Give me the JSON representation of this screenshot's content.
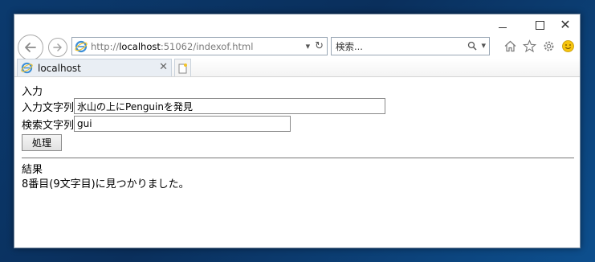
{
  "window": {
    "controls": {
      "minimize": "minimize-icon",
      "maximize": "maximize-icon",
      "close": "close-icon"
    }
  },
  "navbar": {
    "address": {
      "url_prefix": "http://",
      "url_host": "localhost",
      "url_rest": ":51062/indexof.html"
    },
    "search_placeholder": "検索...",
    "toolbar_icons": [
      "home-icon",
      "star-icon",
      "gear-icon",
      "smiley-icon"
    ]
  },
  "tabs": [
    {
      "label": "localhost",
      "active": true
    }
  ],
  "form": {
    "section_title": "入力",
    "input_label": "入力文字列",
    "input_value": "氷山の上にPenguinを発見",
    "search_label": "検索文字列",
    "search_value": "gui",
    "process_button": "処理"
  },
  "result": {
    "title": "結果",
    "message": "8番目(9文字目)に見つかりました。"
  },
  "colors": {
    "accent": "#1e73be",
    "ie_blue": "#3c8fd8",
    "ie_gold": "#f4c326"
  }
}
